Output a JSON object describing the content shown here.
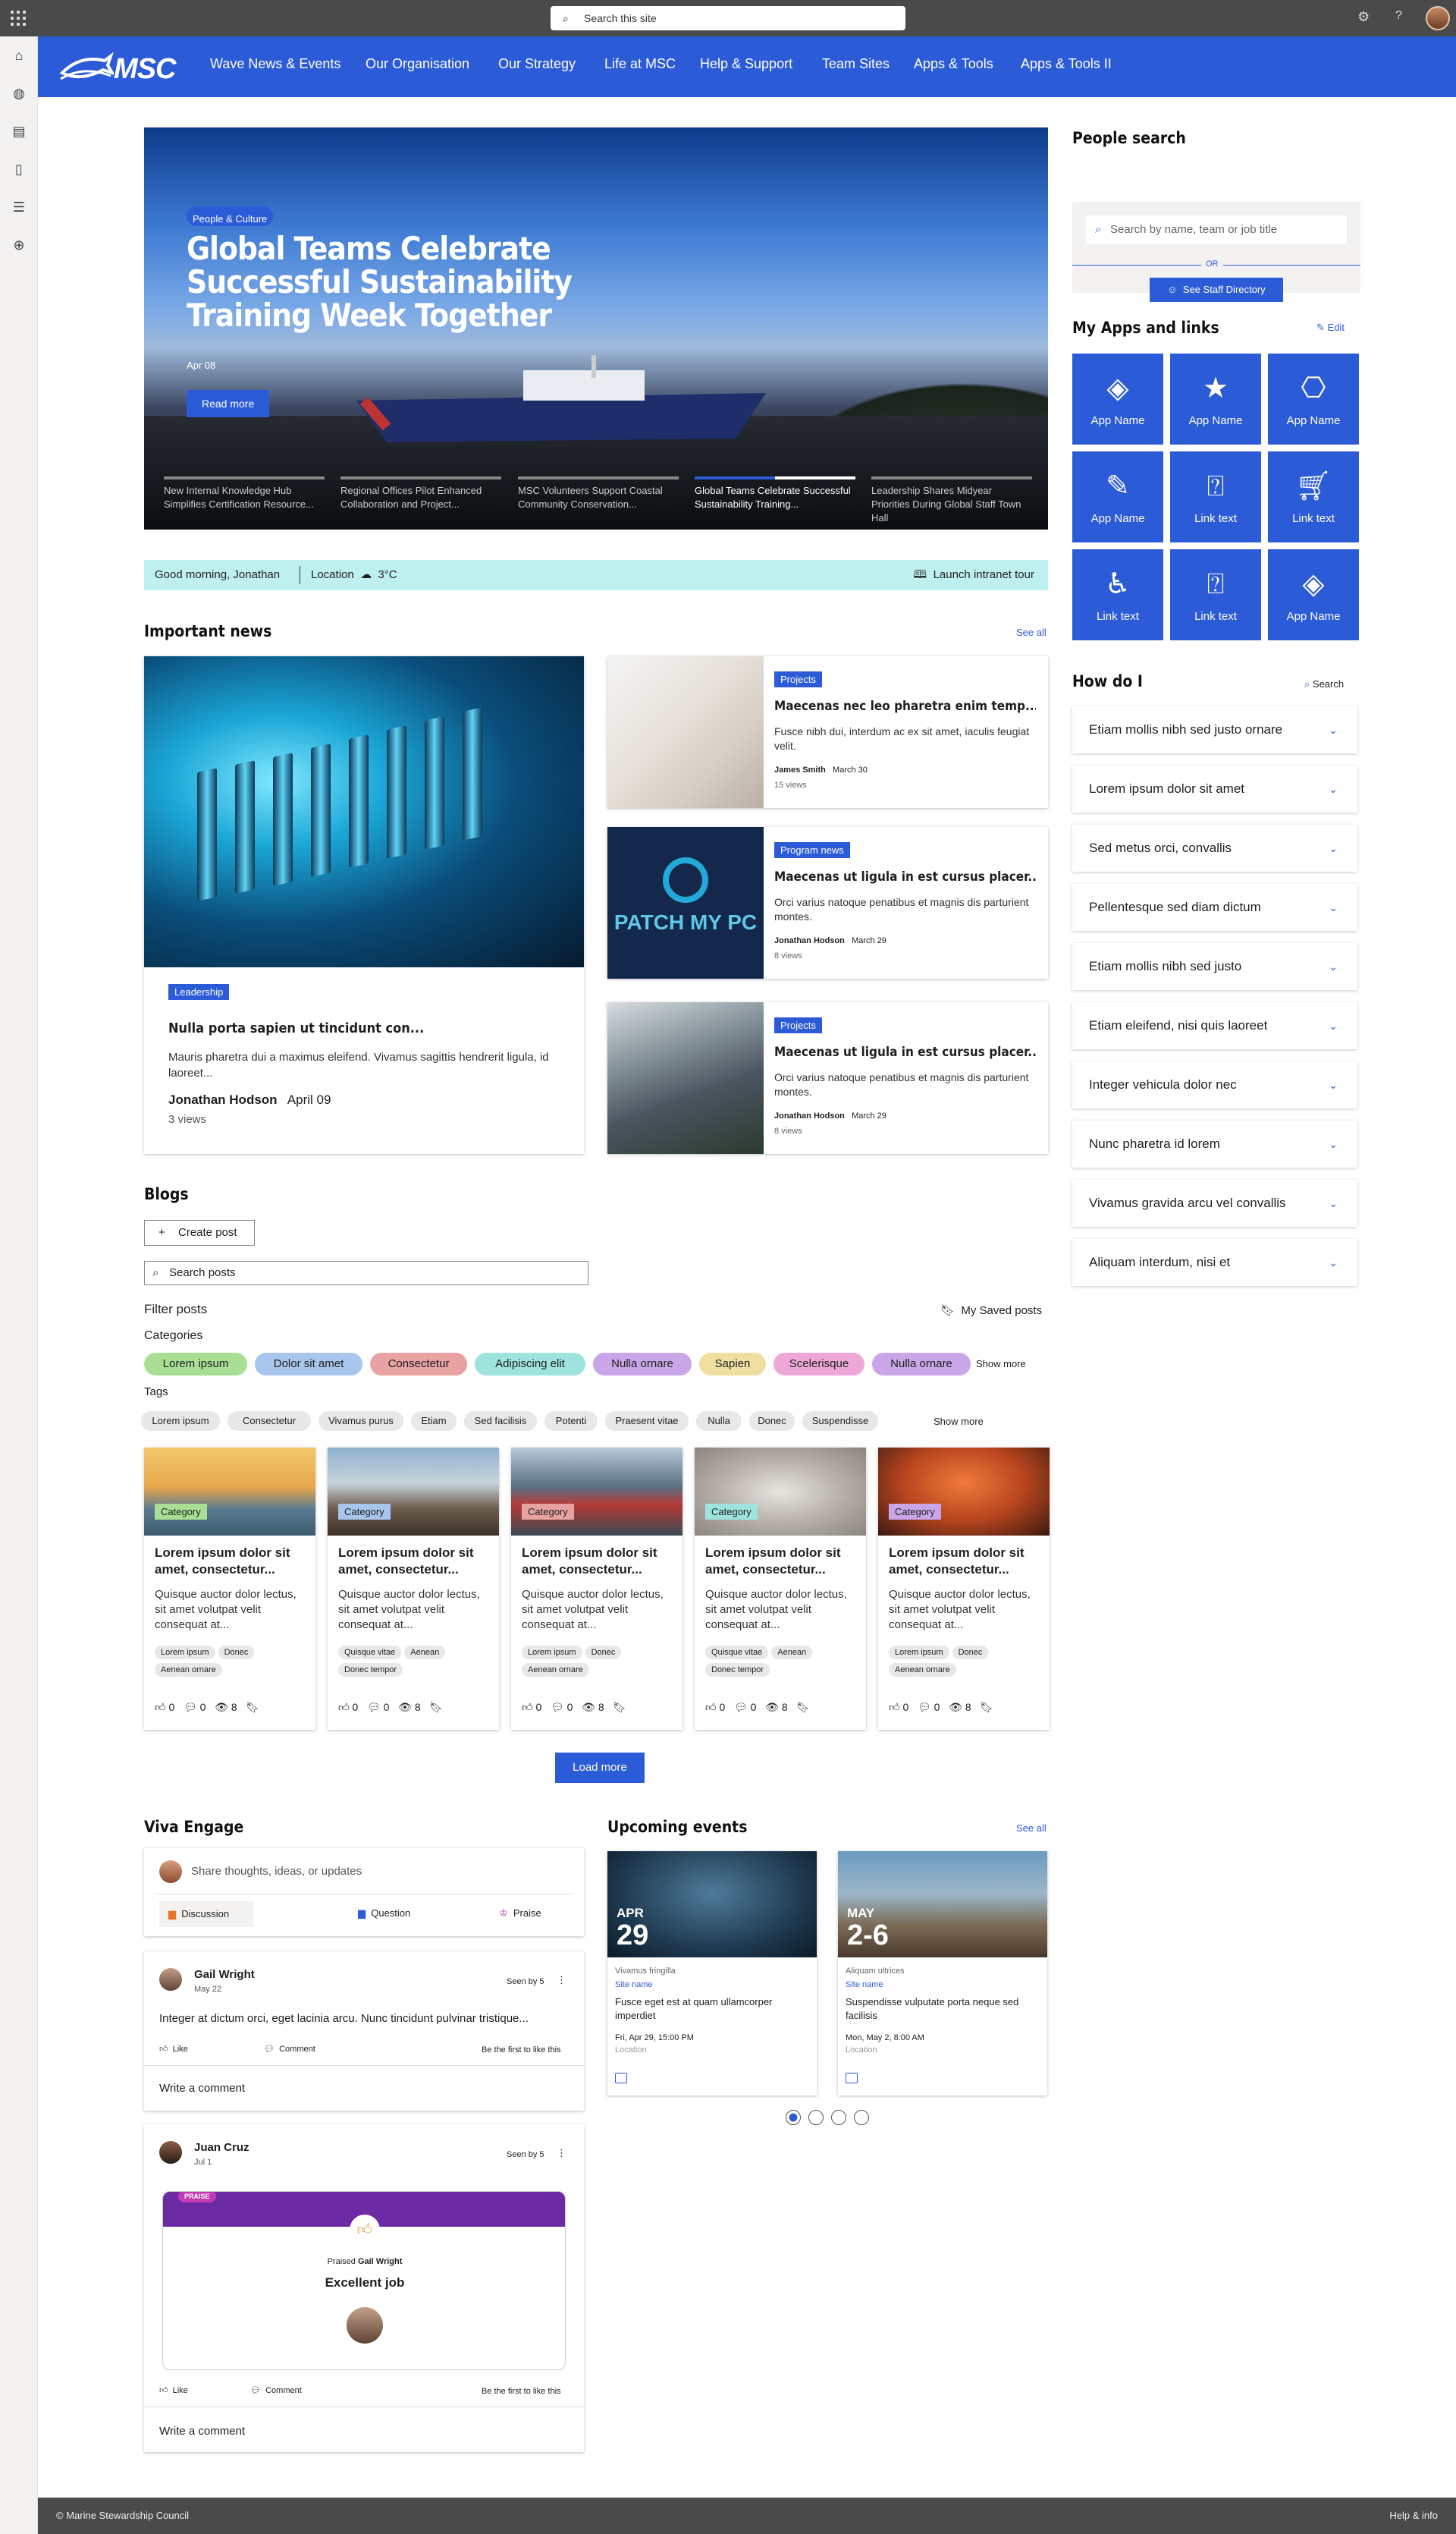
{
  "topbar": {
    "search_placeholder": "Search this site",
    "icons": [
      "waffle-icon",
      "gear-icon",
      "help-icon"
    ]
  },
  "brand": {
    "logo_text": "MSC",
    "accent": "#2b5bd7"
  },
  "nav": {
    "items": [
      "Wave News & Events",
      "Our Organisation",
      "Our Strategy",
      "Life at MSC",
      "Help & Support",
      "Team Sites",
      "Apps & Tools",
      "Apps & Tools II"
    ]
  },
  "hero": {
    "tag": "People & Culture",
    "title": "Global Teams Celebrate Successful Sustainability Training Week Together",
    "date": "Apr 08",
    "read_more": "Read more",
    "thumbs": [
      "New Internal Knowledge Hub Simplifies Certification Resource...",
      "Regional Offices Pilot Enhanced Collaboration and Project...",
      "MSC Volunteers Support Coastal Community Conservation...",
      "Global Teams Celebrate Successful Sustainability Training...",
      "Leadership Shares Midyear Priorities During Global Staff Town Hall"
    ]
  },
  "greeting": {
    "hello": "Good morning, Jonathan",
    "location_label": "Location",
    "temp": "3°C",
    "tour": "Launch intranet tour"
  },
  "important_news": {
    "title": "Important news",
    "see_all": "See all",
    "featured": {
      "tag": "Leadership",
      "title": "Nulla porta sapien ut tincidunt con...",
      "desc": "Mauris pharetra dui a maximus eleifend. Vivamus sagittis hendrerit ligula, id laoreet...",
      "author": "Jonathan Hodson",
      "date": "April 09",
      "views": "3 views"
    },
    "items": [
      {
        "tag": "Projects",
        "title": "Maecenas nec leo pharetra enim temp...",
        "desc": "Fusce nibh dui, interdum ac ex sit amet, iaculis feugiat velit.",
        "author": "James Smith",
        "date": "March 30",
        "views": "15 views"
      },
      {
        "tag": "Program news",
        "title": "Maecenas ut ligula in est cursus placer...",
        "desc": "Orci varius natoque penatibus et magnis dis parturient montes.",
        "author": "Jonathan Hodson",
        "date": "March 29",
        "views": "8 views"
      },
      {
        "tag": "Projects",
        "title": "Maecenas ut ligula in est cursus placer...",
        "desc": "Orci varius natoque penatibus et magnis dis parturient montes.",
        "author": "Jonathan Hodson",
        "date": "March 29",
        "views": "8 views"
      }
    ],
    "patch_logo": "PATCH MY PC"
  },
  "blogs": {
    "title": "Blogs",
    "create_post": "Create post",
    "search_placeholder": "Search posts",
    "filter_posts": "Filter posts",
    "saved": "My Saved posts",
    "categories_label": "Categories",
    "categories": [
      {
        "name": "Lorem ipsum",
        "color": "#a9df94"
      },
      {
        "name": "Dolor sit amet",
        "color": "#a8c6ec"
      },
      {
        "name": "Consectetur",
        "color": "#e8a2a2"
      },
      {
        "name": "Adipiscing elit",
        "color": "#9fe3de"
      },
      {
        "name": "Nulla ornare",
        "color": "#c9a6e8"
      },
      {
        "name": "Sapien",
        "color": "#efe0a2"
      },
      {
        "name": "Scelerisque",
        "color": "#eda8d8"
      },
      {
        "name": "Nulla ornare",
        "color": "#c9a6e8"
      }
    ],
    "tags_label": "Tags",
    "tags": [
      "Lorem ipsum",
      "Consectetur",
      "Vivamus purus",
      "Etiam",
      "Sed facilisis",
      "Potenti",
      "Praesent vitae",
      "Nulla",
      "Donec",
      "Suspendisse"
    ],
    "show_more": "Show more",
    "posts": [
      {
        "category": "Category",
        "cat_color": "#a9df94",
        "title": "Lorem ipsum dolor sit amet, consectetur...",
        "desc": "Quisque auctor dolor lectus, sit amet volutpat velit consequat at...",
        "tags": [
          "Lorem ipsum",
          "Donec",
          "Aenean ornare"
        ],
        "likes": "0",
        "comments": "0",
        "views": "8"
      },
      {
        "category": "Category",
        "cat_color": "#a8c6ec",
        "title": "Lorem ipsum dolor sit amet, consectetur...",
        "desc": "Quisque auctor dolor lectus, sit amet volutpat velit consequat at...",
        "tags": [
          "Quisque vitae",
          "Aenean",
          "Donec tempor"
        ],
        "likes": "0",
        "comments": "0",
        "views": "8"
      },
      {
        "category": "Category",
        "cat_color": "#e8a2a2",
        "title": "Lorem ipsum dolor sit amet, consectetur...",
        "desc": "Quisque auctor dolor lectus, sit amet volutpat velit consequat at...",
        "tags": [
          "Lorem ipsum",
          "Donec",
          "Aenean ornare"
        ],
        "likes": "0",
        "comments": "0",
        "views": "8"
      },
      {
        "category": "Category",
        "cat_color": "#9fe3de",
        "title": "Lorem ipsum dolor sit amet, consectetur...",
        "desc": "Quisque auctor dolor lectus, sit amet volutpat velit consequat at...",
        "tags": [
          "Quisque vitae",
          "Aenean",
          "Donec tempor"
        ],
        "likes": "0",
        "comments": "0",
        "views": "8"
      },
      {
        "category": "Category",
        "cat_color": "#c9a6e8",
        "title": "Lorem ipsum dolor sit amet, consectetur...",
        "desc": "Quisque auctor dolor lectus, sit amet volutpat velit consequat at...",
        "tags": [
          "Lorem ipsum",
          "Donec",
          "Aenean ornare"
        ],
        "likes": "0",
        "comments": "0",
        "views": "8"
      }
    ],
    "load_more": "Load more"
  },
  "viva": {
    "title": "Viva Engage",
    "composer_placeholder": "Share thoughts, ideas, or updates",
    "discussion": "Discussion",
    "question": "Question",
    "praise": "Praise",
    "posts": [
      {
        "author": "Gail Wright",
        "date": "May 22",
        "seen": "Seen by 5",
        "text": "Integer at dictum orci, eget lacinia arcu. Nunc tincidunt pulvinar tristique...",
        "like": "Like",
        "comment": "Comment",
        "first": "Be the first to like this",
        "write": "Write a comment"
      },
      {
        "author": "Juan Cruz",
        "date": "Jul 1",
        "seen": "Seen by 5",
        "praise_badge": "PRAISE",
        "praised_prefix": "Praised",
        "praised_name": "Gail Wright",
        "praise_title": "Excellent job",
        "like": "Like",
        "comment": "Comment",
        "first": "Be the first to like this",
        "write": "Write a comment"
      }
    ]
  },
  "events": {
    "title": "Upcoming events",
    "see_all": "See all",
    "items": [
      {
        "month": "APR",
        "day": "29",
        "category": "Vivamus fringilla",
        "site": "Site name",
        "title": "Fusce eget est at quam ullamcorper imperdiet",
        "when": "Fri, Apr 29, 15:00 PM",
        "location": "Location"
      },
      {
        "month": "MAY",
        "day": "2-6",
        "category": "Aliquam ultrices",
        "site": "Site name",
        "title": "Suspendisse vulputate porta neque sed facilisis",
        "when": "Mon, May 2, 8:00 AM",
        "location": "Location"
      }
    ]
  },
  "people_search": {
    "title": "People search",
    "placeholder": "Search by name, team or job title",
    "or": "OR",
    "directory": "See Staff Directory"
  },
  "apps": {
    "title": "My Apps and links",
    "edit": "Edit",
    "items": [
      {
        "label": "App Name",
        "icon": "diamond-icon"
      },
      {
        "label": "App Name",
        "icon": "star-icon"
      },
      {
        "label": "App Name",
        "icon": "camera-icon"
      },
      {
        "label": "App Name",
        "icon": "pen-icon"
      },
      {
        "label": "Link text",
        "icon": "help-box-icon"
      },
      {
        "label": "Link text",
        "icon": "cart-icon"
      },
      {
        "label": "Link text",
        "icon": "accessibility-icon"
      },
      {
        "label": "Link text",
        "icon": "help-box-icon"
      },
      {
        "label": "App Name",
        "icon": "diamond-icon"
      }
    ]
  },
  "howdo": {
    "title": "How do I",
    "search": "Search",
    "items": [
      "Etiam mollis nibh sed justo ornare",
      "Lorem ipsum dolor sit amet",
      "Sed metus orci, convallis",
      "Pellentesque sed diam dictum",
      "Etiam mollis nibh sed justo",
      "Etiam eleifend, nisi quis laoreet",
      "Integer vehicula dolor nec",
      "Nunc pharetra id lorem",
      "Vivamus gravida arcu vel convallis",
      "Aliquam interdum, nisi et"
    ]
  },
  "footer": {
    "copyright": "© Marine Stewardship Council",
    "help": "Help & info"
  }
}
